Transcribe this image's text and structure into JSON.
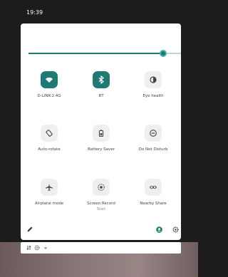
{
  "status_bar": {
    "time": "19:39"
  },
  "brightness": {
    "level": 0.9,
    "accent_color": "#1f7a73"
  },
  "tiles": [
    {
      "label": "D-LINK-2.4G",
      "sub": "",
      "icon": "wifi-icon",
      "active": true
    },
    {
      "label": "BT",
      "sub": "",
      "icon": "bluetooth-icon",
      "active": true
    },
    {
      "label": "Eye health",
      "sub": "",
      "icon": "contrast-icon",
      "active": false
    },
    {
      "label": "Auto-rotate",
      "sub": "",
      "icon": "rotate-icon",
      "active": false
    },
    {
      "label": "Battery Saver",
      "sub": "",
      "icon": "battery-icon",
      "active": false
    },
    {
      "label": "Do Not Disturb",
      "sub": "",
      "icon": "do-not-disturb-icon",
      "active": false
    },
    {
      "label": "Airplane mode",
      "sub": "",
      "icon": "airplane-icon",
      "active": false
    },
    {
      "label": "Screen Record",
      "sub": "Start",
      "icon": "screen-record-icon",
      "active": false
    },
    {
      "label": "Nearby Share",
      "sub": "",
      "icon": "nearby-share-icon",
      "active": false
    }
  ],
  "footer": {
    "edit_icon": "pencil-icon",
    "user_icon": "user-icon",
    "settings_icon": "gear-icon"
  },
  "bottom_bar": {
    "icons": [
      "transfer-icon",
      "gear-icon",
      "chevron-icon"
    ]
  }
}
